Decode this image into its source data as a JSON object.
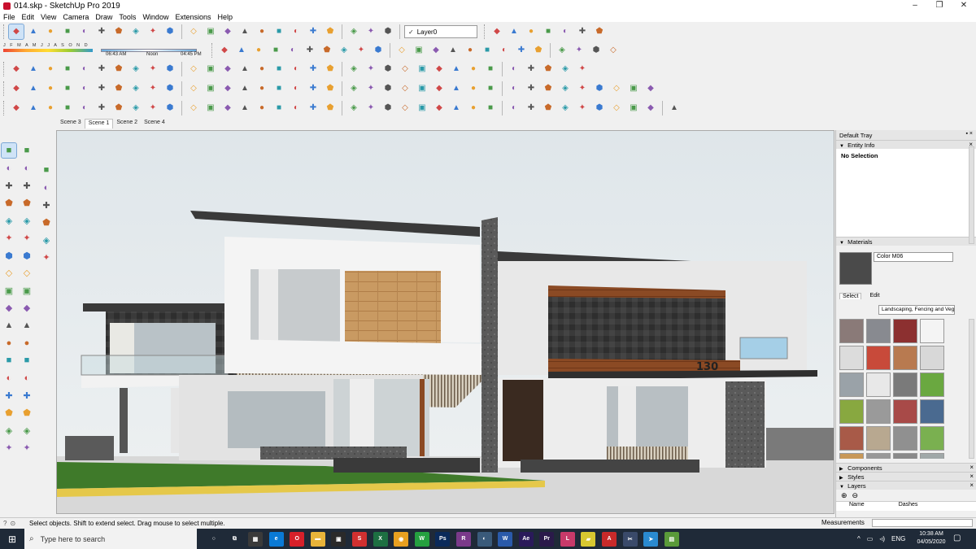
{
  "window": {
    "title": "014.skp - SketchUp Pro 2019",
    "minimize": "–",
    "maximize": "❐",
    "close": "✕"
  },
  "menu": [
    "File",
    "Edit",
    "View",
    "Camera",
    "Draw",
    "Tools",
    "Window",
    "Extensions",
    "Help"
  ],
  "toolbar": {
    "layer_dropdown": {
      "checkmark": "✓",
      "value": "Layer0"
    },
    "shadow": {
      "months": "J F M A M J J A S O N D",
      "time_start": "06:43 AM",
      "time_noon": "Noon",
      "time_end": "04:45 PM"
    },
    "row1_icons": [
      "select-icon",
      "eraser-icon",
      "line-icon",
      "arc-icon",
      "paint-bucket-icon",
      "push-pull-icon",
      "follow-me-icon",
      "move-icon",
      "rotate-icon",
      "scale-icon",
      "tape-measure-icon",
      "text-icon",
      "paint-icon",
      "orbit-icon",
      "pan-icon",
      "zoom-icon",
      "zoom-extents-icon",
      "warehouse-icon",
      "extension-warehouse-icon",
      "layout-icon",
      "ruby-icon",
      "user-icon"
    ],
    "row1b_icons": [
      "iso-view-icon",
      "top-view-icon",
      "front-view-icon",
      "right-view-icon",
      "back-view-icon",
      "left-view-icon",
      "bottom-view-icon"
    ],
    "row2_icons": [
      "sandbox-icon",
      "smoove-icon",
      "new-icon",
      "open-icon",
      "save-icon",
      "cut-icon",
      "copy-icon",
      "paste-icon",
      "pencil-icon",
      "ruler-icon",
      "rect-icon",
      "circle-icon",
      "ellipse-icon",
      "oval-icon",
      "polygon-icon",
      "arc2-icon",
      "arc3-icon",
      "arc4-icon",
      "curve-icon",
      "star-icon",
      "spiral-icon",
      "offset-icon",
      "fillet-icon"
    ],
    "row3_icons": [
      "map-icon",
      "play-icon",
      "stop-icon",
      "settings-icon",
      "cube-icon",
      "cylinder-icon",
      "cone-icon",
      "pyramid-icon",
      "sphere-icon",
      "torus-icon",
      "prism-icon",
      "helix-icon",
      "dome-icon",
      "tube-icon",
      "wedge-icon",
      "polyhedron-icon",
      "gem-icon",
      "bolt-icon",
      "ring-icon",
      "axis-x-icon",
      "axis-y-icon",
      "axis-z-icon",
      "reset-icon",
      "component-icon",
      "group-icon",
      "explode-icon",
      "solid-icon",
      "intersect-icon",
      "union-icon",
      "subtract-icon",
      "trim-icon",
      "split-icon",
      "shell-icon"
    ],
    "row4_icons": [
      "line-tool-icon",
      "curve-tool-icon",
      "join-icon",
      "weld-icon",
      "split-line-icon",
      "bend-icon",
      "loft-icon",
      "extrude-icon",
      "sweep-icon",
      "lathe-icon",
      "skin-icon",
      "cap-icon",
      "profile-icon",
      "stairs-icon",
      "rail-icon",
      "wall-icon",
      "window-tool-icon",
      "door-tool-icon",
      "roof-icon",
      "beam-icon",
      "column-icon",
      "truss-icon",
      "slab-icon",
      "grid-icon",
      "array-icon",
      "mirror-icon",
      "align-icon",
      "distribute-icon",
      "snap-icon",
      "measure-icon",
      "area-icon",
      "volume-icon",
      "label-icon",
      "dimension-icon",
      "section-icon",
      "cloud-icon",
      "share-icon"
    ],
    "row5_icons": [
      "box-icon",
      "plane-icon",
      "terrain-icon",
      "hill-icon",
      "valley-icon",
      "cut-plane-icon",
      "drape-icon",
      "stamp-icon",
      "flip-icon",
      "smooth-icon",
      "add-detail-icon",
      "lock-icon",
      "unlock-icon",
      "hide-icon",
      "unhide-icon",
      "rotate3d-icon",
      "scale3d-icon",
      "twist-icon",
      "taper-icon",
      "shear-icon",
      "path-icon",
      "chain-icon",
      "link-icon",
      "unlink-icon",
      "weld2-icon",
      "merge-icon",
      "node-icon",
      "vertex-icon",
      "face-icon",
      "edge-icon",
      "soften-icon",
      "render-icon",
      "material-icon",
      "light-icon",
      "camera-icon",
      "tag-icon",
      "material2-icon",
      "palette-icon"
    ]
  },
  "scenes": [
    "Scene 3",
    "Scene 1",
    "Scene 2",
    "Scene 4"
  ],
  "left_toolbar": {
    "col1": [
      "select-tool-icon",
      "paint-bucket-tool-icon",
      "line-tool-icon",
      "rectangle-tool-icon",
      "circle-tool-icon",
      "arc-tool-icon",
      "offset-tool-icon",
      "push-pull-tool-icon",
      "rotate-tool-icon",
      "scale-tool-icon",
      "tape-measure-tool-icon",
      "dimension-tool-icon",
      "text-tool-icon",
      "orbit-tool-icon",
      "zoom-tool-icon",
      "zoom-extents-tool-icon",
      "position-camera-tool-icon",
      "walk-tool-icon"
    ],
    "col2": [
      "make-component-icon",
      "eraser-tool-icon",
      "freehand-tool-icon",
      "rotated-rect-tool-icon",
      "polygon-tool-icon",
      "pie-tool-icon",
      "two-point-arc-icon",
      "follow-me-tool-icon",
      "move-tool-icon",
      "offset2-tool-icon",
      "protractor-tool-icon",
      "axes-tool-icon",
      "3d-text-tool-icon",
      "pan-tool-icon",
      "zoom-window-tool-icon",
      "previous-view-icon",
      "look-around-tool-icon",
      "section-plane-tool-icon"
    ],
    "col3": [
      "warehouse-small-icon",
      "component-small-icon",
      "home-icon",
      "house-front-icon",
      "house-icon",
      "door-small-icon"
    ]
  },
  "viewport": {
    "house_number": "130"
  },
  "tray": {
    "title": "Default Tray",
    "pin": "▪ ×",
    "entity_info": {
      "header": "Entity Info",
      "value": "No Selection"
    },
    "materials": {
      "header": "Materials",
      "name": "Color M06",
      "tabs": [
        "Select",
        "Edit"
      ],
      "library": "Landscaping, Fencing and Vegetation",
      "swatch_colors": [
        "#8a7a78",
        "#888a90",
        "#8c3030",
        "#f4f4f4",
        "#dcdcdc",
        "#c84a3a",
        "#b87a50",
        "#d8d8d8",
        "#9aa2a8",
        "#e8e8e8",
        "#7a7a7a",
        "#6aa840",
        "#88a840",
        "#9a9a9a",
        "#a84a48",
        "#4a6a90",
        "#a85a48",
        "#b8a890",
        "#909090",
        "#7ab050",
        "#c89858",
        "#989898",
        "#8a8a8a",
        "#a0a8a8"
      ]
    },
    "components": "Components",
    "styles": "Styles",
    "layers": {
      "header": "Layers",
      "add": "⊕",
      "remove": "⊖",
      "col_name": "Name",
      "col_dashes": "Dashes"
    }
  },
  "status": {
    "message": "Select objects. Shift to extend select. Drag mouse to select multiple.",
    "measurements_label": "Measurements"
  },
  "taskbar": {
    "search_placeholder": "Type here to search",
    "apps": [
      {
        "name": "cortana-icon",
        "label": "○",
        "color": "#1f2a38"
      },
      {
        "name": "task-view-icon",
        "label": "⧉",
        "color": "#1f2a38"
      },
      {
        "name": "calculator-icon",
        "label": "▦",
        "color": "#3a3a3a"
      },
      {
        "name": "edge-icon",
        "label": "e",
        "color": "#0a7ad6"
      },
      {
        "name": "opera-icon",
        "label": "O",
        "color": "#d6202a"
      },
      {
        "name": "file-explorer-icon",
        "label": "▬",
        "color": "#e8b43a"
      },
      {
        "name": "store-icon",
        "label": "▣",
        "color": "#2a2a2a"
      },
      {
        "name": "sketchup-icon",
        "label": "S",
        "color": "#d03030"
      },
      {
        "name": "excel-icon",
        "label": "X",
        "color": "#1d6f42"
      },
      {
        "name": "chrome-icon",
        "label": "◉",
        "color": "#e8a020"
      },
      {
        "name": "whatsapp-icon",
        "label": "W",
        "color": "#25a040"
      },
      {
        "name": "photoshop-icon",
        "label": "Ps",
        "color": "#0a2a5a"
      },
      {
        "name": "winrar-icon",
        "label": "R",
        "color": "#7a3a8a"
      },
      {
        "name": "connect-icon",
        "label": "◐",
        "color": "#3a5a7a"
      },
      {
        "name": "word-icon",
        "label": "W",
        "color": "#2a5aaa"
      },
      {
        "name": "after-effects-icon",
        "label": "Ae",
        "color": "#2a1a5a"
      },
      {
        "name": "premiere-icon",
        "label": "Pr",
        "color": "#2a1a4a"
      },
      {
        "name": "sketchup-layout-icon",
        "label": "L",
        "color": "#c83a6a"
      },
      {
        "name": "sticky-icon",
        "label": "▰",
        "color": "#d8c830"
      },
      {
        "name": "acrobat-icon",
        "label": "A",
        "color": "#c82a2a"
      },
      {
        "name": "snip-icon",
        "label": "✂",
        "color": "#3a4a6a"
      },
      {
        "name": "telegram-icon",
        "label": "➤",
        "color": "#2a8ad0"
      },
      {
        "name": "notepad-icon",
        "label": "▤",
        "color": "#5a9a3a"
      }
    ],
    "tray_chevron": "^",
    "network": "▭",
    "volume": "◃)",
    "language": "ENG",
    "time": "10:38 AM",
    "date": "04/05/2020",
    "notification": "▢"
  },
  "colors": {
    "accent_select": "#cfe3f7",
    "taskbar": "#1f2a38",
    "wall_white": "#f4f4f4",
    "wood": "#b77c4a",
    "stone_dark": "#3c3c3c",
    "grass": "#3f7a2a"
  }
}
